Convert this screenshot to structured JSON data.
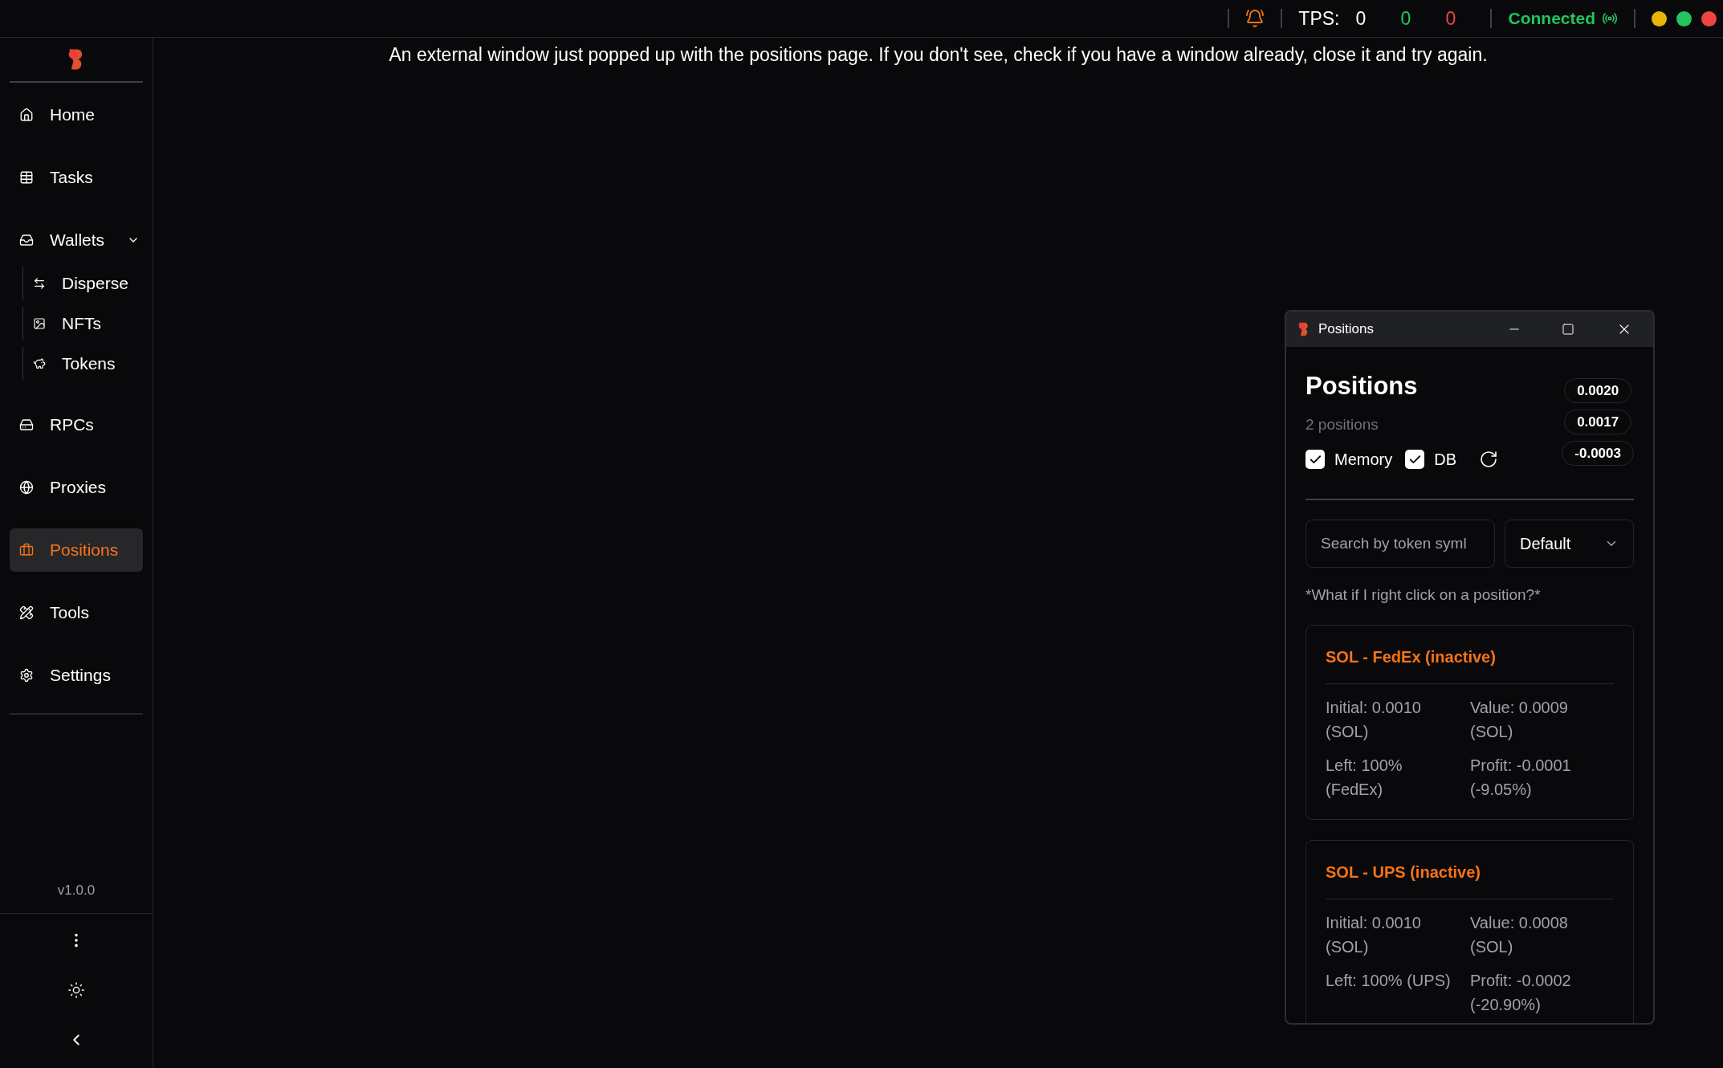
{
  "top_bar": {
    "tps_label": "TPS:",
    "tps_values": [
      {
        "value": "0",
        "color": "#ffffff"
      },
      {
        "value": "0",
        "color": "#22c55e"
      },
      {
        "value": "0",
        "color": "#ef4444"
      }
    ],
    "connection": {
      "label": "Connected",
      "connected": true
    },
    "dots": [
      {
        "color": "#eab308"
      },
      {
        "color": "#22c55e"
      },
      {
        "color": "#ef4444"
      }
    ]
  },
  "sidebar": {
    "items": [
      {
        "label": "Home",
        "selected": false
      },
      {
        "label": "Tasks",
        "selected": false
      },
      {
        "label": "Wallets",
        "selected": false,
        "expanded": true,
        "children": [
          {
            "label": "Disperse",
            "selected": false
          },
          {
            "label": "NFTs",
            "selected": false
          },
          {
            "label": "Tokens",
            "selected": false
          }
        ]
      },
      {
        "label": "RPCs",
        "selected": false
      },
      {
        "label": "Proxies",
        "selected": false
      },
      {
        "label": "Positions",
        "selected": true
      },
      {
        "label": "Tools",
        "selected": false
      },
      {
        "label": "Settings",
        "selected": false
      }
    ],
    "version": "v1.0.0"
  },
  "banner": "An external window just popped up with the positions page. If you don't see, check if you have a window already, close it and try again.",
  "positions_window": {
    "title": "Positions",
    "heading": "Positions",
    "count": "2 positions",
    "badges": [
      "0.0020",
      "0.0017",
      "-0.0003"
    ],
    "checkboxes": [
      {
        "label": "Memory",
        "checked": true
      },
      {
        "label": "DB",
        "checked": true
      }
    ],
    "search": {
      "placeholder": "Search by token syml"
    },
    "sort": {
      "value": "Default"
    },
    "hint": "*What if I right click on a position?*",
    "positions": [
      {
        "title": "SOL - FedEx (inactive)",
        "initial": "Initial: 0.0010 (SOL)",
        "value": "Value: 0.0009 (SOL)",
        "left": "Left: 100% (FedEx)",
        "profit": "Profit: -0.0001 (-9.05%)"
      },
      {
        "title": "SOL - UPS (inactive)",
        "initial": "Initial: 0.0010 (SOL)",
        "value": "Value: 0.0008 (SOL)",
        "left": "Left: 100% (UPS)",
        "profit": "Profit: -0.0002 (-20.90%)"
      }
    ]
  }
}
